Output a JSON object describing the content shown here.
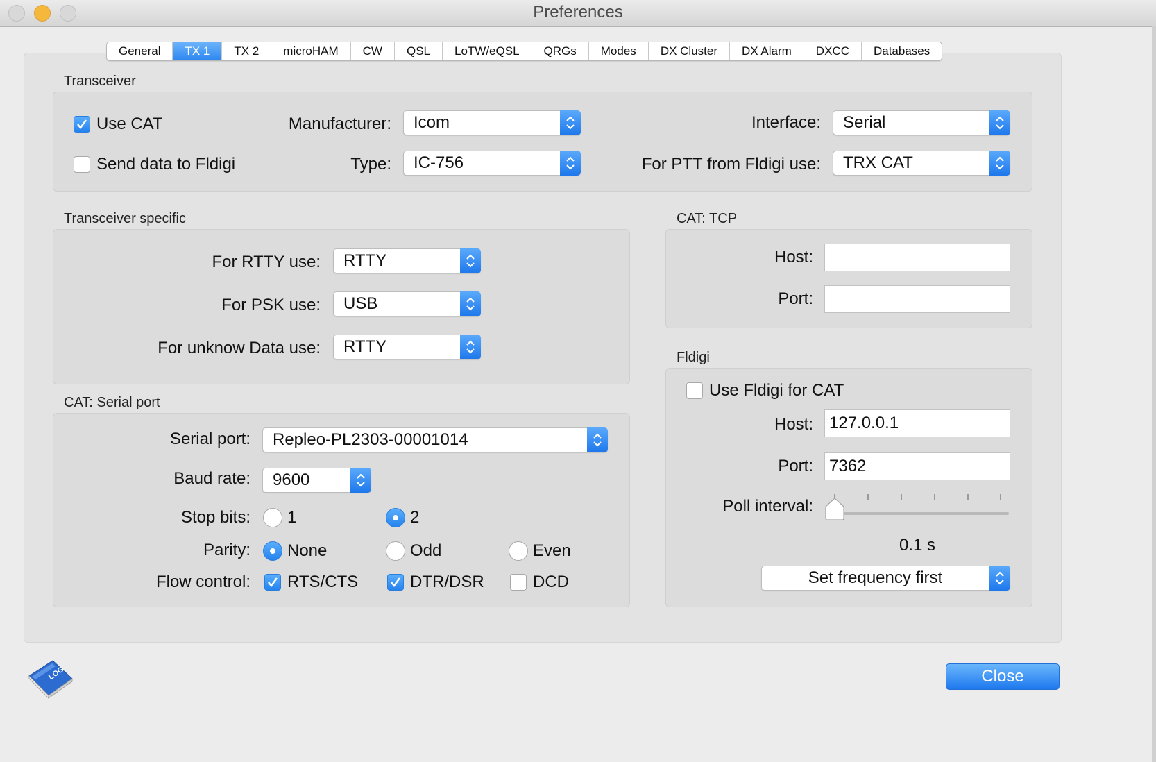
{
  "window": {
    "title": "Preferences"
  },
  "tabs": [
    "General",
    "TX 1",
    "TX 2",
    "microHAM",
    "CW",
    "QSL",
    "LoTW/eQSL",
    "QRGs",
    "Modes",
    "DX Cluster",
    "DX Alarm",
    "DXCC",
    "Databases"
  ],
  "active_tab": "TX 1",
  "transceiver": {
    "group_label": "Transceiver",
    "use_cat_label": "Use CAT",
    "use_cat_checked": true,
    "send_fldigi_label": "Send data to Fldigi",
    "send_fldigi_checked": false,
    "manufacturer_label": "Manufacturer:",
    "manufacturer_value": "Icom",
    "type_label": "Type:",
    "type_value": "IC-756",
    "interface_label": "Interface:",
    "interface_value": "Serial",
    "ptt_label": "For PTT from Fldigi use:",
    "ptt_value": "TRX CAT"
  },
  "transceiver_specific": {
    "group_label": "Transceiver specific",
    "rtty_label": "For RTTY use:",
    "rtty_value": "RTTY",
    "psk_label": "For PSK use:",
    "psk_value": "USB",
    "unknown_label": "For unknow Data use:",
    "unknown_value": "RTTY"
  },
  "cat_tcp": {
    "group_label": "CAT: TCP",
    "host_label": "Host:",
    "host_value": "",
    "port_label": "Port:",
    "port_value": ""
  },
  "serial_port": {
    "group_label": "CAT: Serial port",
    "port_label": "Serial port:",
    "port_value": "Repleo-PL2303-00001014",
    "baud_label": "Baud rate:",
    "baud_value": "9600",
    "stop_bits_label": "Stop bits:",
    "stop_bits_options": [
      "1",
      "2"
    ],
    "stop_bits_selected": "2",
    "parity_label": "Parity:",
    "parity_options": [
      "None",
      "Odd",
      "Even"
    ],
    "parity_selected": "None",
    "flow_label": "Flow control:",
    "flow_rts_label": "RTS/CTS",
    "flow_rts_checked": true,
    "flow_dtr_label": "DTR/DSR",
    "flow_dtr_checked": true,
    "flow_dcd_label": "DCD",
    "flow_dcd_checked": false
  },
  "fldigi": {
    "group_label": "Fldigi",
    "use_label": "Use Fldigi for CAT",
    "use_checked": false,
    "host_label": "Host:",
    "host_value": "127.0.0.1",
    "port_label": "Port:",
    "port_value": "7362",
    "poll_label": "Poll interval:",
    "poll_value_text": "0.1 s",
    "poll_slider_fraction": 0,
    "mode_value": "Set frequency first"
  },
  "footer": {
    "close_label": "Close",
    "logo_text": "LOG"
  },
  "colors": {
    "accent": "#2d87f0",
    "panel": "#e3e3e3",
    "box": "#dcdcdc"
  }
}
